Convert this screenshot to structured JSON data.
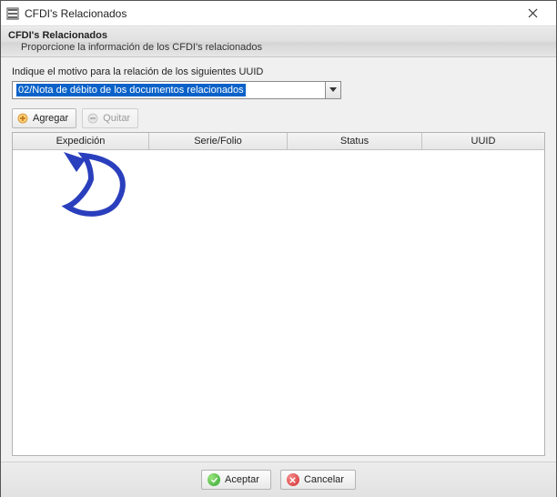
{
  "window": {
    "title": "CFDI's Relacionados"
  },
  "header": {
    "title": "CFDI's Relacionados",
    "subtitle": "Proporcione la información de los CFDI's relacionados"
  },
  "form": {
    "prompt": "Indique el motivo para la relación de los siguientes UUID",
    "dropdown_value": "02/Nota de débito de los documentos relacionados"
  },
  "toolbar": {
    "add_label": "Agregar",
    "remove_label": "Quitar"
  },
  "grid": {
    "columns": {
      "expedicion": "Expedición",
      "serie_folio": "Serie/Folio",
      "status": "Status",
      "uuid": "UUID"
    },
    "rows": []
  },
  "footer": {
    "accept_label": "Aceptar",
    "cancel_label": "Cancelar"
  }
}
